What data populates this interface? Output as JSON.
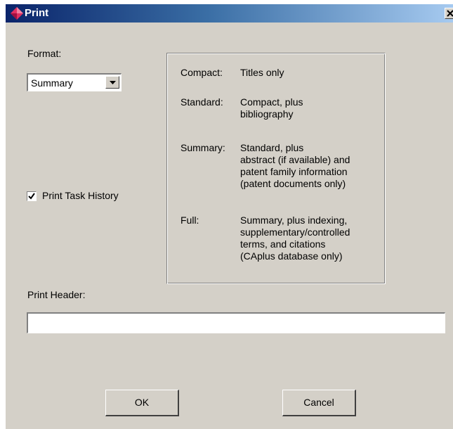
{
  "window": {
    "title": "Print",
    "title_icon": "diamond-app-icon",
    "close_icon": "close-icon"
  },
  "format": {
    "label": "Format:",
    "selected": "Summary",
    "dropdown_icon": "chevron-down-icon"
  },
  "print_task_history": {
    "label": "Print Task History",
    "checked": true
  },
  "formats_info": [
    {
      "name": "Compact:",
      "description": "Titles only"
    },
    {
      "name": "Standard:",
      "description": "Compact, plus\nbibliography"
    },
    {
      "name": "Summary:",
      "description": "Standard, plus\nabstract (if available) and\npatent family information\n(patent documents only)"
    },
    {
      "name": "Full:",
      "description": "Summary, plus indexing,\nsupplementary/controlled\nterms, and citations\n(CAplus database only)"
    }
  ],
  "print_header": {
    "label": "Print Header:",
    "value": ""
  },
  "buttons": {
    "ok": "OK",
    "cancel": "Cancel"
  },
  "colors": {
    "dialog_bg": "#d4d0c8",
    "titlebar_start": "#0a246a",
    "titlebar_end": "#a6caf0"
  }
}
